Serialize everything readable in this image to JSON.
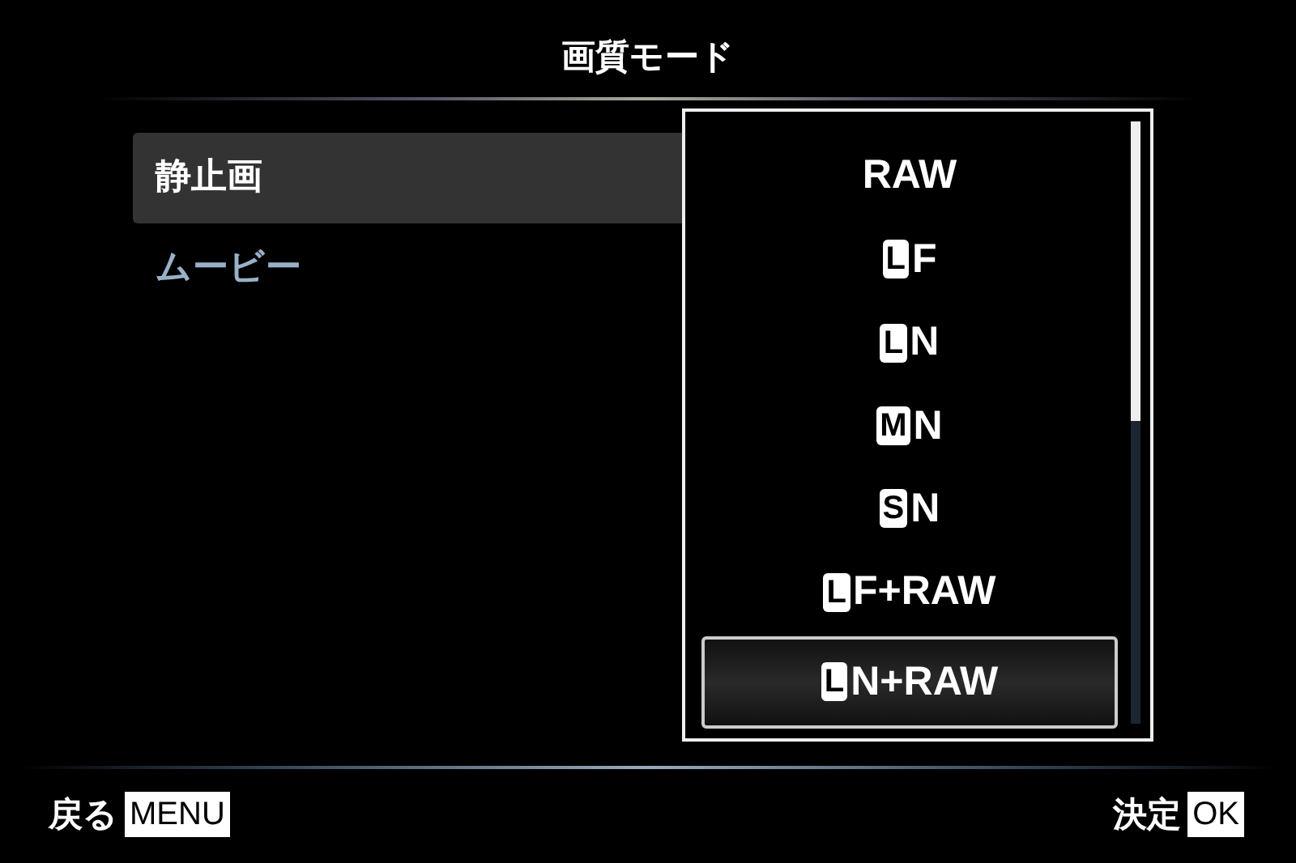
{
  "title": "画質モード",
  "menu": [
    {
      "label": "静止画",
      "selected": true
    },
    {
      "label": "ムービー",
      "selected": false
    }
  ],
  "options": [
    {
      "text": "RAW",
      "selected": false
    },
    {
      "badge": "L",
      "text": "F",
      "selected": false
    },
    {
      "badge": "L",
      "text": "N",
      "selected": false
    },
    {
      "badge": "M",
      "text": "N",
      "selected": false
    },
    {
      "badge": "S",
      "text": "N",
      "selected": false
    },
    {
      "badge": "L",
      "text": "F+RAW",
      "selected": false
    },
    {
      "badge": "L",
      "text": "N+RAW",
      "selected": true
    }
  ],
  "footer": {
    "back_label": "戻る",
    "back_key": "MENU",
    "ok_label": "決定",
    "ok_key": "OK"
  }
}
